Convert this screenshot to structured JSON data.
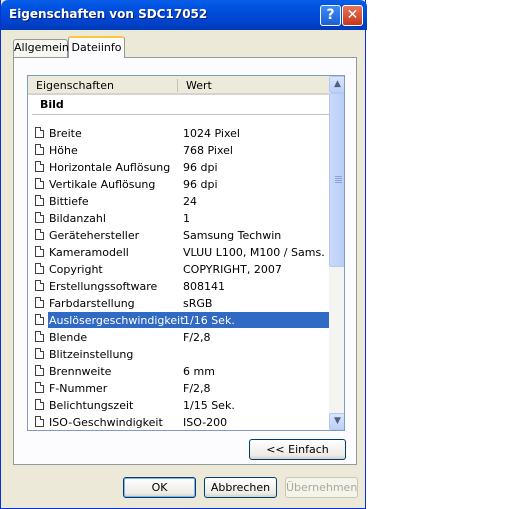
{
  "window": {
    "title": "Eigenschaften von SDC17052"
  },
  "titlebar": {
    "help_label": "?",
    "close_label": "✕"
  },
  "tabs": [
    {
      "label": "Allgemein",
      "active": false
    },
    {
      "label": "Dateiinfo",
      "active": true
    }
  ],
  "list": {
    "columns": [
      "Eigenschaften",
      "Wert"
    ],
    "section": "Bild",
    "rows": [
      {
        "name": "Breite",
        "value": "1024 Pixel"
      },
      {
        "name": "Höhe",
        "value": "768 Pixel"
      },
      {
        "name": "Horizontale Auflösung",
        "value": "96 dpi"
      },
      {
        "name": "Vertikale Auflösung",
        "value": "96 dpi"
      },
      {
        "name": "Bittiefe",
        "value": "24"
      },
      {
        "name": "Bildanzahl",
        "value": "1"
      },
      {
        "name": "Gerätehersteller",
        "value": "Samsung Techwin"
      },
      {
        "name": "Kameramodell",
        "value": "VLUU L100, M100  / Sams…"
      },
      {
        "name": "Copyright",
        "value": "COPYRIGHT, 2007"
      },
      {
        "name": "Erstellungssoftware",
        "value": "808141"
      },
      {
        "name": "Farbdarstellung",
        "value": "sRGB"
      },
      {
        "name": "Auslösergeschwindigkeit",
        "value": "1/16 Sek.",
        "selected": true
      },
      {
        "name": "Blende",
        "value": "F/2,8"
      },
      {
        "name": "Blitzeinstellung",
        "value": ""
      },
      {
        "name": "Brennweite",
        "value": "6 mm"
      },
      {
        "name": "F-Nummer",
        "value": "F/2,8"
      },
      {
        "name": "Belichtungszeit",
        "value": "1/15 Sek."
      },
      {
        "name": "ISO-Geschwindigkeit",
        "value": "ISO-200"
      }
    ]
  },
  "scrollbar": {
    "up_icon": "▲",
    "down_icon": "▼"
  },
  "buttons": {
    "simple": "<< Einfach",
    "ok": "OK",
    "cancel": "Abbrechen",
    "apply": "Übernehmen"
  },
  "colors": {
    "titlebar": "#0054e3",
    "selection": "#316ac5",
    "dialog": "#ece9d8"
  }
}
